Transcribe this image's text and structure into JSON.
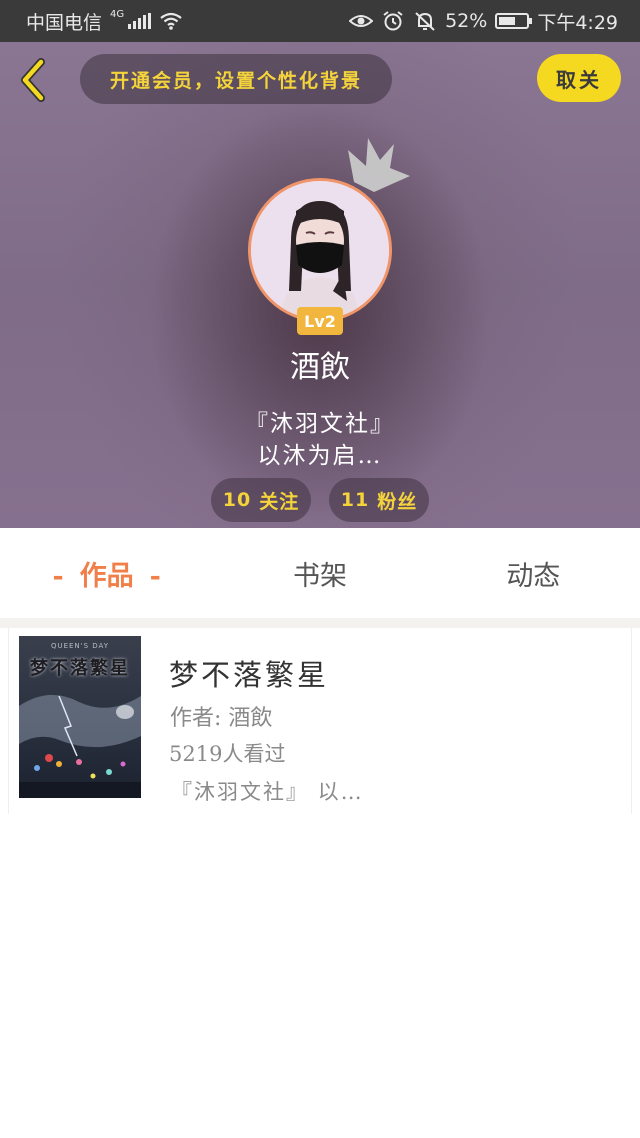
{
  "status_bar": {
    "carrier": "中国电信",
    "network": "4G",
    "battery": "52%",
    "time": "下午4:29"
  },
  "header": {
    "vip_banner": "开通会员，设置个性化背景",
    "cancel_label": "取关"
  },
  "profile": {
    "level": "Lv2",
    "username": "酒飲",
    "bio_line1": "『沐羽文社』",
    "bio_line2": "以沐为启…",
    "follow_count": "10",
    "follow_label": "关注",
    "fans_count": "11",
    "fans_label": "粉丝"
  },
  "tabs": [
    {
      "label": "作品",
      "active": true
    },
    {
      "label": "书架",
      "active": false
    },
    {
      "label": "动态",
      "active": false
    }
  ],
  "tab_active_dash": "-",
  "books": [
    {
      "cover_top": "QUEEN'S DAY",
      "cover_title": "梦不落繁星",
      "title": "梦不落繁星",
      "author": "作者: 酒飲",
      "readers": "5219人看过",
      "description": "『沐羽文社』 以…"
    }
  ],
  "colors": {
    "accent_yellow": "#f5d820",
    "tab_active": "#f07f4a",
    "level_badge": "#f2b63f",
    "avatar_border": "#f0956a"
  }
}
